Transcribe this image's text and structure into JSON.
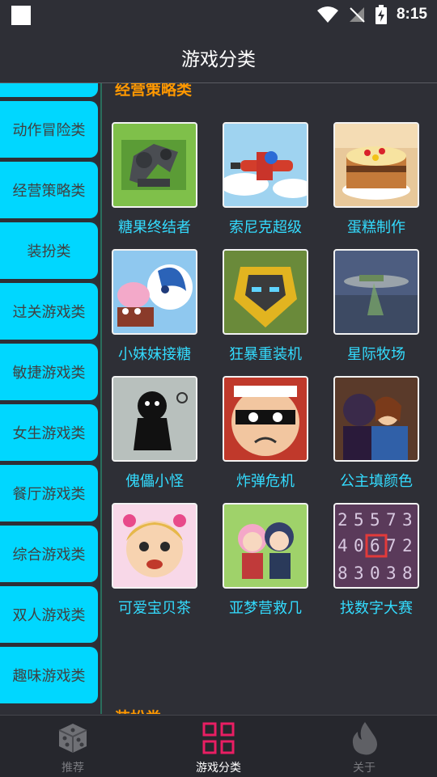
{
  "status_bar": {
    "time": "8:15"
  },
  "header": {
    "title": "游戏分类"
  },
  "sidebar": {
    "items": [
      {
        "label": ""
      },
      {
        "label": "动作冒险类"
      },
      {
        "label": "经营策略类"
      },
      {
        "label": "装扮类"
      },
      {
        "label": "过关游戏类"
      },
      {
        "label": "敏捷游戏类"
      },
      {
        "label": "女生游戏类"
      },
      {
        "label": "餐厅游戏类"
      },
      {
        "label": "综合游戏类"
      },
      {
        "label": "双人游戏类"
      },
      {
        "label": "趣味游戏类"
      }
    ]
  },
  "content": {
    "section_title": "经营策略类",
    "next_section_title": "装扮类",
    "games": [
      {
        "name": "糖果终结者"
      },
      {
        "name": "索尼克超级"
      },
      {
        "name": "蛋糕制作"
      },
      {
        "name": "小妹妹接糖"
      },
      {
        "name": "狂暴重装机"
      },
      {
        "name": "星际牧场"
      },
      {
        "name": "傀儡小怪"
      },
      {
        "name": "炸弹危机"
      },
      {
        "name": "公主填颜色"
      },
      {
        "name": "可爱宝贝茶"
      },
      {
        "name": "亚梦营救几"
      },
      {
        "name": "找数字大赛"
      }
    ],
    "number_puzzle_digits": [
      "2",
      "5",
      "5",
      "7",
      "3",
      "4",
      "0",
      "6",
      "7",
      "2",
      "8",
      "3",
      "0",
      "3",
      "8"
    ]
  },
  "bottom_nav": {
    "items": [
      {
        "label": "推荐"
      },
      {
        "label": "游戏分类"
      },
      {
        "label": "关于"
      }
    ],
    "active_index": 1
  },
  "colors": {
    "background": "#2e2f36",
    "sidebar_item": "#00d7ff",
    "section_title": "#ff9800",
    "game_name": "#33dcff",
    "active_nav_icon": "#e91e63"
  }
}
